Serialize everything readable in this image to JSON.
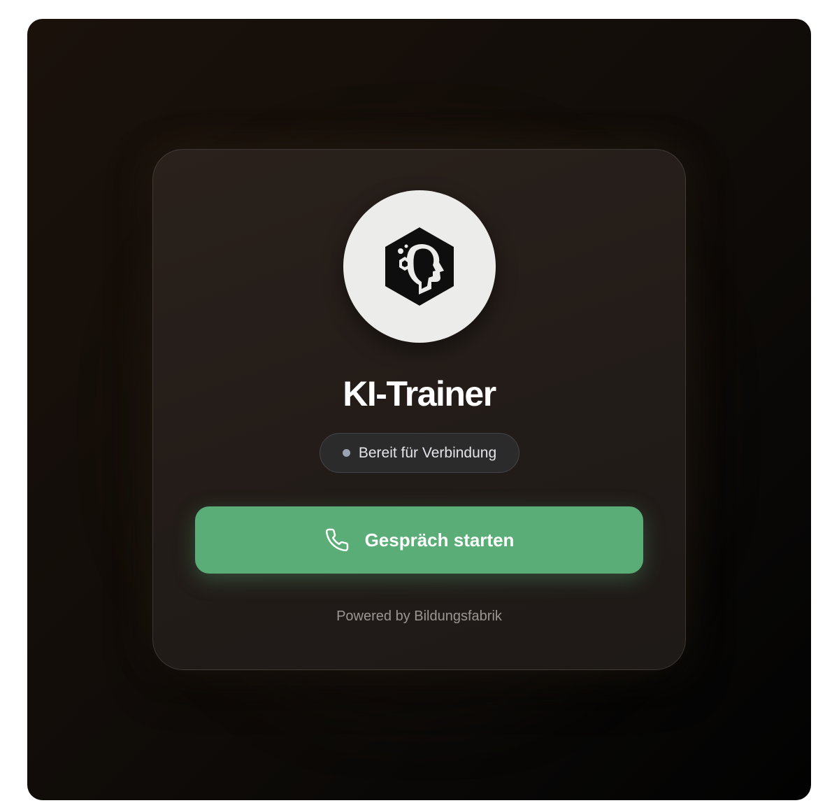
{
  "app": {
    "title": "KI-Trainer",
    "logo_icon": "hexagon-head-logo-icon"
  },
  "status": {
    "label": "Bereit für Verbindung",
    "dot_color": "#9ba2b4"
  },
  "call_button": {
    "label": "Gespräch starten",
    "icon": "phone-icon",
    "color": "#5aad77"
  },
  "footer": {
    "powered_by": "Powered by Bildungsfabrik"
  }
}
